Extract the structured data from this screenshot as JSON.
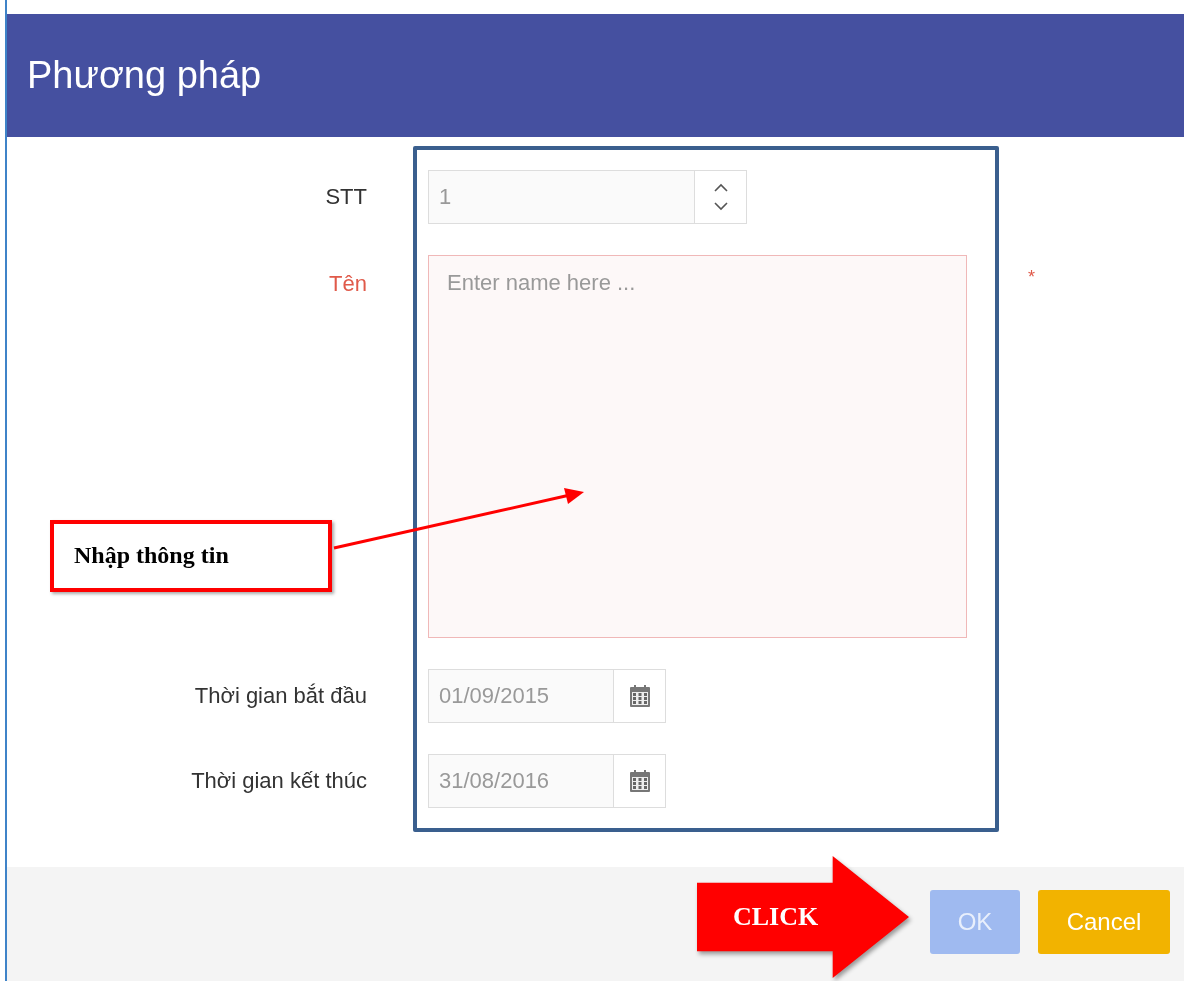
{
  "window": {
    "title": "Phương pháp"
  },
  "fields": [
    {
      "kind": "number",
      "label": "STT",
      "value": "1",
      "required": false
    },
    {
      "kind": "textarea",
      "label": "Tên",
      "placeholder": "Enter name here ...",
      "required": true,
      "required_mark": "*"
    },
    {
      "kind": "date",
      "label": "Thời gian bắt đầu",
      "value": "01/09/2015",
      "required": false
    },
    {
      "kind": "date",
      "label": "Thời gian kết thúc",
      "value": "31/08/2016",
      "required": false
    }
  ],
  "buttons": [
    {
      "label": "OK",
      "kind": "primary",
      "disabled": true
    },
    {
      "label": "Cancel",
      "kind": "warning",
      "disabled": false
    }
  ],
  "annotations": {
    "callout": "Nhập thông tin",
    "click_arrow": "CLICK"
  }
}
